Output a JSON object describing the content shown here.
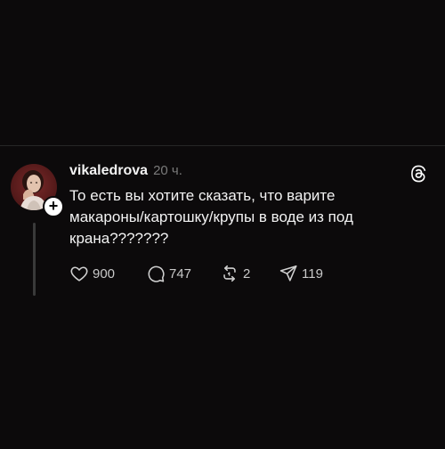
{
  "post": {
    "username": "vikaledrova",
    "time": "20 ч.",
    "text": "То есть вы хотите сказать, что варите\nмакароны/картошку/крупы в воде из под\nкрана???????",
    "follow_symbol": "+",
    "stats": {
      "likes": "900",
      "replies": "747",
      "reposts": "2",
      "shares": "119"
    }
  },
  "icons": {
    "like": "heart-icon",
    "reply": "speech-bubble-icon",
    "repost": "repost-arrows-icon",
    "share": "paper-plane-icon",
    "brand": "threads-logo-icon"
  },
  "colors": {
    "background": "#0c0a0b",
    "text": "#f3f3f3",
    "muted": "#7a7a7a",
    "divider": "#262626"
  }
}
